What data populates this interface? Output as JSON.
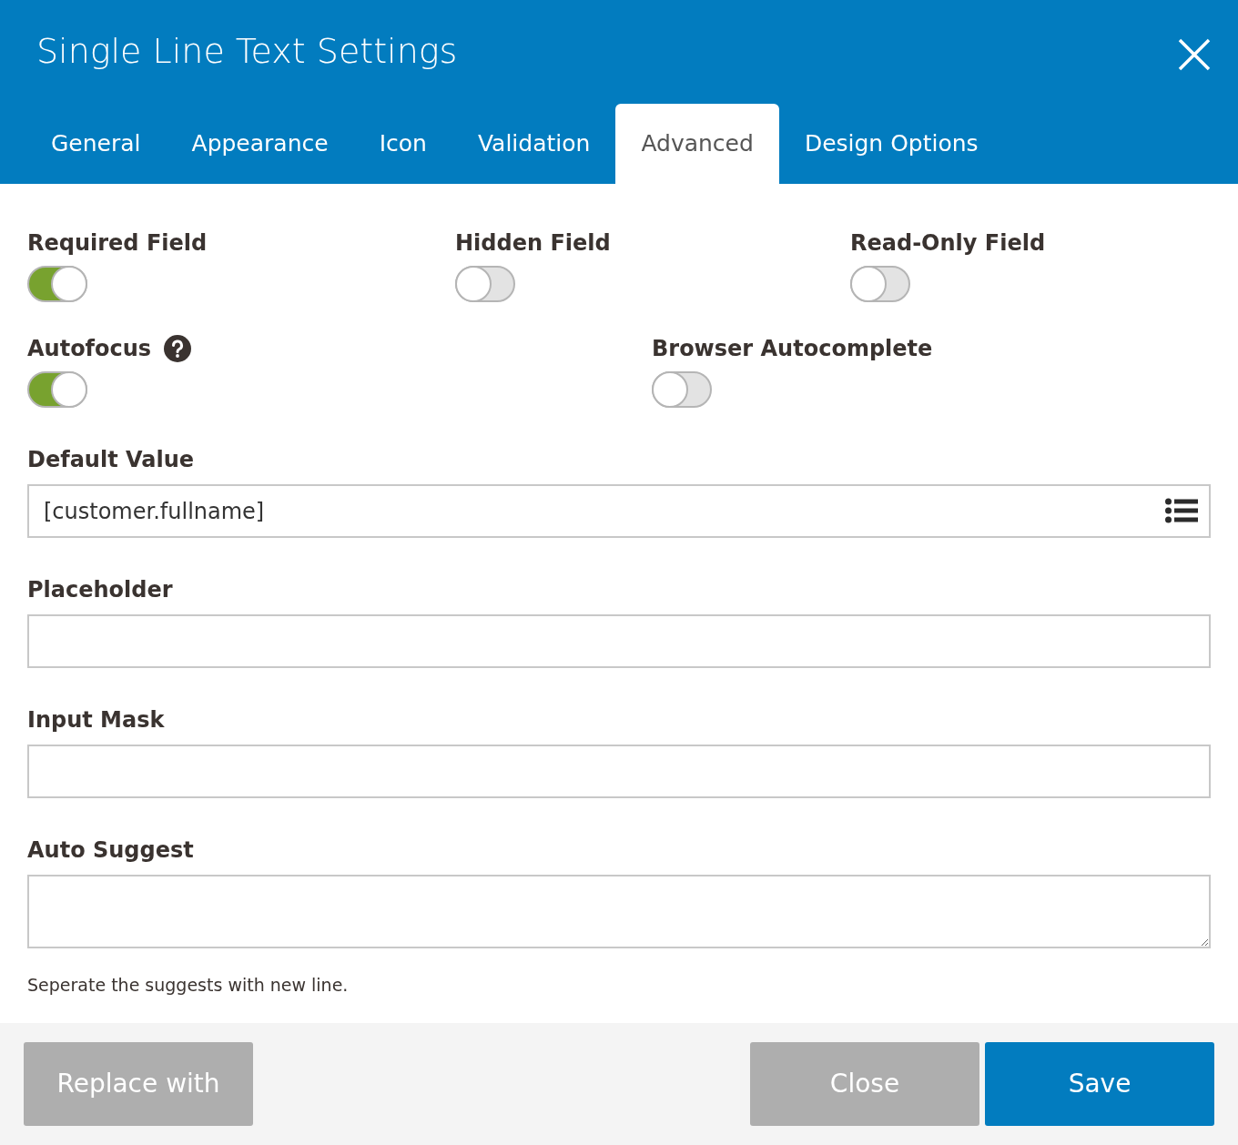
{
  "dialog": {
    "title": "Single Line Text Settings"
  },
  "tabs": [
    {
      "label": "General",
      "selected": false
    },
    {
      "label": "Appearance",
      "selected": false
    },
    {
      "label": "Icon",
      "selected": false
    },
    {
      "label": "Validation",
      "selected": false
    },
    {
      "label": "Advanced",
      "selected": true
    },
    {
      "label": "Design Options",
      "selected": false
    }
  ],
  "toggle_rows": [
    [
      {
        "label": "Required Field",
        "on": true,
        "help": false
      },
      {
        "label": "Hidden Field",
        "on": false,
        "help": false
      },
      {
        "label": "Read-Only Field",
        "on": false,
        "help": false
      }
    ],
    [
      {
        "label": "Autofocus",
        "on": true,
        "help": true
      },
      {
        "label": "Browser Autocomplete",
        "on": false,
        "help": false
      }
    ]
  ],
  "fields": [
    {
      "label": "Default Value",
      "kind": "input",
      "value": "[customer.fullname]",
      "menu": true
    },
    {
      "label": "Placeholder",
      "kind": "input",
      "menu": false
    },
    {
      "label": "Input Mask",
      "kind": "input",
      "menu": false
    },
    {
      "label": "Auto Suggest",
      "kind": "textarea",
      "menu": false,
      "hint": "Seperate the suggests with new line."
    }
  ],
  "footer": {
    "left": [
      {
        "label": "Replace with",
        "kind": "secondary"
      }
    ],
    "right": [
      {
        "label": "Close",
        "kind": "secondary"
      },
      {
        "label": "Save",
        "kind": "primary"
      }
    ]
  }
}
